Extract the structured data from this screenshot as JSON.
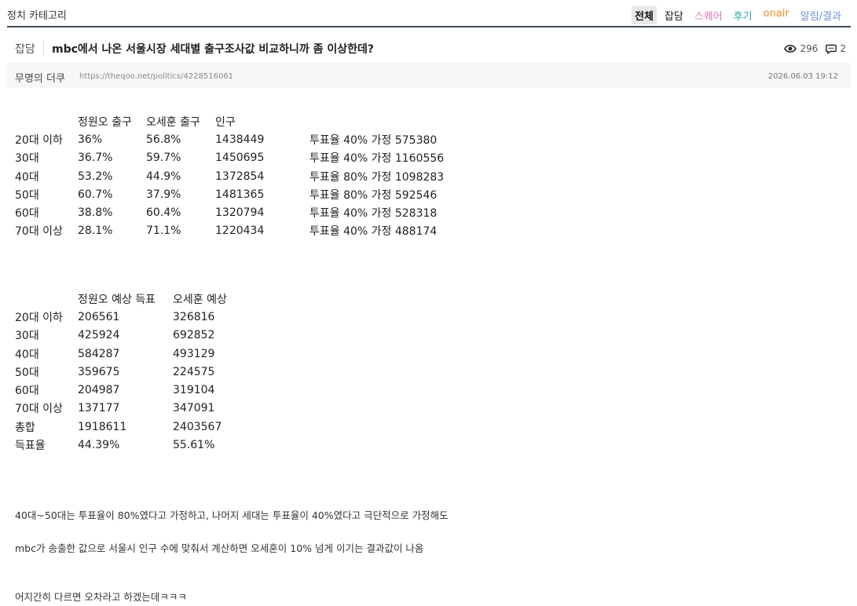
{
  "header": {
    "category_title": "정치 카테고리",
    "tabs": [
      {
        "label": "전체",
        "color": "#111111",
        "active": true
      },
      {
        "label": "잡담",
        "color": "#111111",
        "active": false
      },
      {
        "label": "스퀘어",
        "color": "#e07bb5",
        "active": false
      },
      {
        "label": "후기",
        "color": "#2aa5a8",
        "active": false
      },
      {
        "label": "onair",
        "color": "#f08a2a",
        "active": false
      },
      {
        "label": "알림/결과",
        "color": "#6f8fd8",
        "active": false
      }
    ]
  },
  "post": {
    "category": "잡담",
    "title": "mbc에서 나온 서울시장 세대별 출구조사값 비교하니까 좀 이상한데?",
    "views": "296",
    "comments": "2",
    "author": "무명의 더쿠",
    "url": "https://theqoo.net/politics/4228516061",
    "datetime": "2026.06.03 19:12"
  },
  "table1": {
    "headers": [
      "",
      "정원오 출구",
      "오세훈 출구",
      "인구",
      ""
    ],
    "rows": [
      [
        "20대 이하",
        "36%",
        "56.8%",
        "1438449",
        "투표율 40% 가정  575380"
      ],
      [
        "30대",
        "36.7%",
        "59.7%",
        "1450695",
        "투표율 40% 가정  1160556"
      ],
      [
        "40대",
        "53.2%",
        "44.9%",
        "1372854",
        "투표율 80% 가정  1098283"
      ],
      [
        "50대",
        "60.7%",
        "37.9%",
        "1481365",
        "투표율 80% 가정  592546"
      ],
      [
        "60대",
        "38.8%",
        "60.4%",
        "1320794",
        "투표율 40% 가정  528318"
      ],
      [
        "70대 이상",
        "28.1%",
        "71.1%",
        "1220434",
        "투표율 40% 가정  488174"
      ]
    ]
  },
  "table2": {
    "headers": [
      "",
      "정원오 예상 득표",
      "오세훈 예상"
    ],
    "rows": [
      [
        "20대 이하",
        "206561",
        "326816"
      ],
      [
        "30대",
        "425924",
        "692852"
      ],
      [
        "40대",
        "584287",
        "493129"
      ],
      [
        "50대",
        "359675",
        "224575"
      ],
      [
        "60대",
        "204987",
        "319104"
      ],
      [
        "70대 이상",
        "137177",
        "347091"
      ],
      [
        "총합",
        "1918611",
        "2403567"
      ],
      [
        "득표율",
        "44.39%",
        "55.61%"
      ]
    ]
  },
  "paragraphs": [
    "40대~50대는 투표율이 80%였다고 가정하고, 나머지 세대는 투표율이 40%였다고 극단적으로 가정해도",
    "mbc가 송출한 값으로 서울시 인구 수에 맞춰서 계산하면 오세훈이 10% 넘게 이기는 결과값이 나옴",
    "어지간히 다르면 오차라고 하겠는데ㅋㅋㅋ"
  ]
}
